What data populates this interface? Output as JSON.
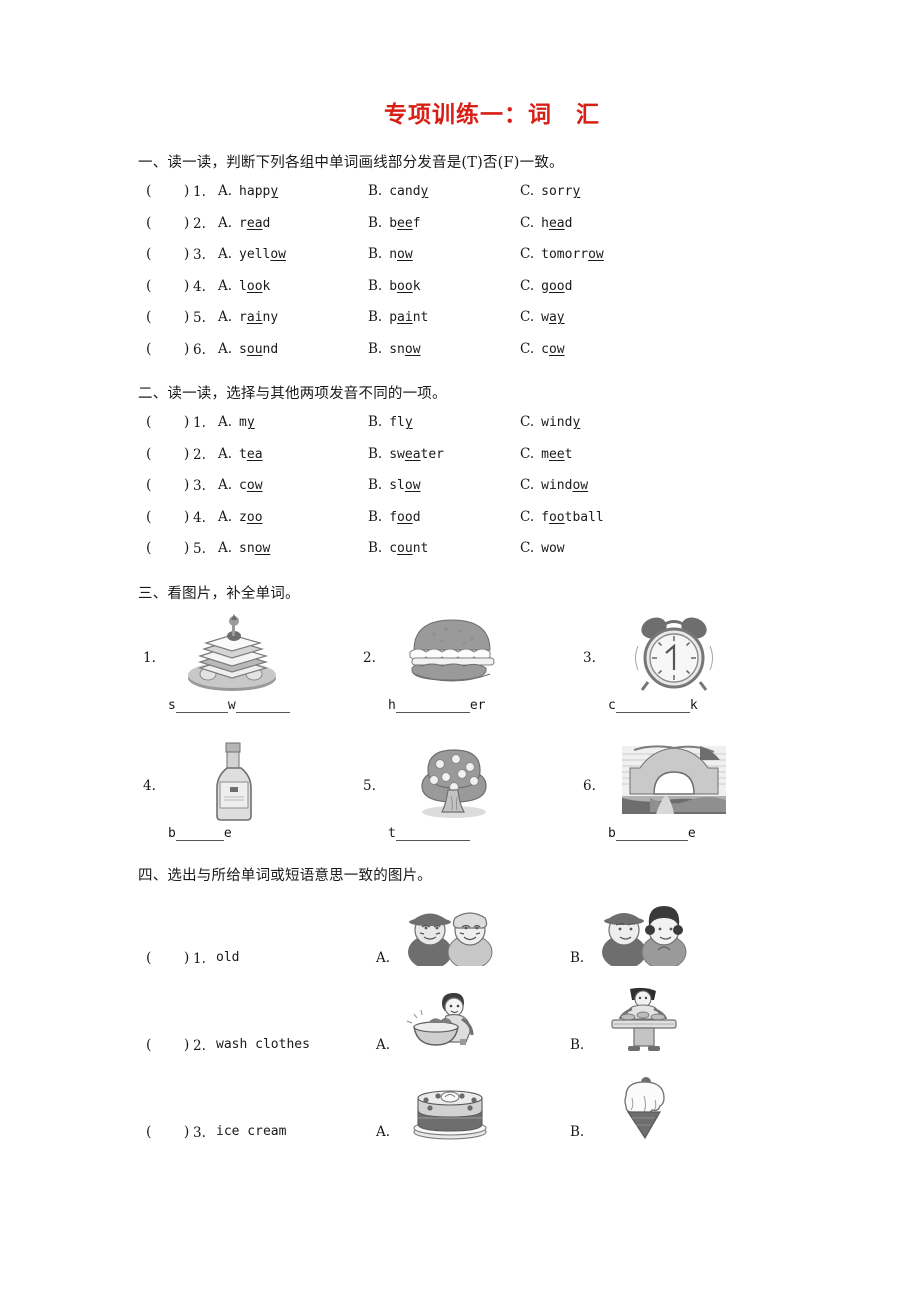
{
  "document": {
    "title": "专项训练一：词　汇",
    "title_color": "#d81f15"
  },
  "sections": [
    {
      "id": "section-1",
      "heading": "一、读一读，判断下列各组中单词画线部分发音是(T)否(F)一致。",
      "paren": "(    )",
      "questions": [
        {
          "num": "1.",
          "options": [
            {
              "label": "A.",
              "pre": "happ",
              "under": "y",
              "post": ""
            },
            {
              "label": "B.",
              "pre": "cand",
              "under": "y",
              "post": ""
            },
            {
              "label": "C.",
              "pre": "sorr",
              "under": "y",
              "post": ""
            }
          ]
        },
        {
          "num": "2.",
          "options": [
            {
              "label": "A.",
              "pre": "r",
              "under": "ea",
              "post": "d"
            },
            {
              "label": "B.",
              "pre": "b",
              "under": "ee",
              "post": "f"
            },
            {
              "label": "C.",
              "pre": "h",
              "under": "ea",
              "post": "d"
            }
          ]
        },
        {
          "num": "3.",
          "options": [
            {
              "label": "A.",
              "pre": "yell",
              "under": "ow",
              "post": ""
            },
            {
              "label": "B.",
              "pre": "n",
              "under": "ow",
              "post": ""
            },
            {
              "label": "C.",
              "pre": "tomorr",
              "under": "ow",
              "post": ""
            }
          ]
        },
        {
          "num": "4.",
          "options": [
            {
              "label": "A.",
              "pre": "l",
              "under": "oo",
              "post": "k"
            },
            {
              "label": "B.",
              "pre": "b",
              "under": "oo",
              "post": "k"
            },
            {
              "label": "C.",
              "pre": "g",
              "under": "oo",
              "post": "d"
            }
          ]
        },
        {
          "num": "5.",
          "options": [
            {
              "label": "A.",
              "pre": "r",
              "under": "ai",
              "post": "ny"
            },
            {
              "label": "B.",
              "pre": "p",
              "under": "ai",
              "post": "nt"
            },
            {
              "label": "C.",
              "pre": "w",
              "under": "ay",
              "post": ""
            }
          ]
        },
        {
          "num": "6.",
          "options": [
            {
              "label": "A.",
              "pre": "s",
              "under": "ou",
              "post": "nd"
            },
            {
              "label": "B.",
              "pre": "sn",
              "under": "ow",
              "post": ""
            },
            {
              "label": "C.",
              "pre": "c",
              "under": "ow",
              "post": ""
            }
          ]
        }
      ]
    },
    {
      "id": "section-2",
      "heading": "二、读一读，选择与其他两项发音不同的一项。",
      "paren": "(    )",
      "questions": [
        {
          "num": "1.",
          "options": [
            {
              "label": "A.",
              "pre": "m",
              "under": "y",
              "post": ""
            },
            {
              "label": "B.",
              "pre": "fl",
              "under": "y",
              "post": ""
            },
            {
              "label": "C.",
              "pre": "wind",
              "under": "y",
              "post": ""
            }
          ]
        },
        {
          "num": "2.",
          "options": [
            {
              "label": "A.",
              "pre": "t",
              "under": "ea",
              "post": ""
            },
            {
              "label": "B.",
              "pre": "sw",
              "under": "ea",
              "post": "ter"
            },
            {
              "label": "C.",
              "pre": "m",
              "under": "ee",
              "post": "t"
            }
          ]
        },
        {
          "num": "3.",
          "options": [
            {
              "label": "A.",
              "pre": "c",
              "under": "ow",
              "post": ""
            },
            {
              "label": "B.",
              "pre": "sl",
              "under": "ow",
              "post": ""
            },
            {
              "label": "C.",
              "pre": "wind",
              "under": "ow",
              "post": ""
            }
          ]
        },
        {
          "num": "4.",
          "options": [
            {
              "label": "A.",
              "pre": "z",
              "under": "oo",
              "post": ""
            },
            {
              "label": "B.",
              "pre": "f",
              "under": "oo",
              "post": "d"
            },
            {
              "label": "C.",
              "pre": "f",
              "under": "oo",
              "post": "tball"
            }
          ]
        },
        {
          "num": "5.",
          "options": [
            {
              "label": "A.",
              "pre": "sn",
              "under": "ow",
              "post": ""
            },
            {
              "label": "B.",
              "pre": "c",
              "under": "ou",
              "post": "nt"
            },
            {
              "label": "C.",
              "pre": "wow",
              "under": "",
              "post": ""
            }
          ]
        }
      ]
    },
    {
      "id": "section-3",
      "heading": "三、看图片，补全单词。",
      "items": [
        {
          "num": "1.",
          "picture": "sandwich-image",
          "blank_before": "s",
          "blank_mid": "w",
          "blank_after": ""
        },
        {
          "num": "2.",
          "picture": "hamburger-image",
          "blank_before": "h",
          "blank_mid": "",
          "blank_after": "er"
        },
        {
          "num": "3.",
          "picture": "alarm-clock-image",
          "blank_before": "c",
          "blank_mid": "",
          "blank_after": "k"
        },
        {
          "num": "4.",
          "picture": "bottle-image",
          "blank_before": "b",
          "blank_mid": "",
          "blank_after": "e"
        },
        {
          "num": "5.",
          "picture": "tree-image",
          "blank_before": "t",
          "blank_mid": "",
          "blank_after": ""
        },
        {
          "num": "6.",
          "picture": "bridge-image",
          "blank_before": "b",
          "blank_mid": "",
          "blank_after": "e"
        }
      ]
    },
    {
      "id": "section-4",
      "heading": "四、选出与所给单词或短语意思一致的图片。",
      "paren": "(    )",
      "questions": [
        {
          "num": "1.",
          "prompt": "old",
          "options": [
            {
              "label": "A.",
              "picture": "old-couple-image"
            },
            {
              "label": "B.",
              "picture": "young-couple-image"
            }
          ]
        },
        {
          "num": "2.",
          "prompt": "wash clothes",
          "options": [
            {
              "label": "A.",
              "picture": "washing-clothes-image"
            },
            {
              "label": "B.",
              "picture": "cooking-at-table-image"
            }
          ]
        },
        {
          "num": "3.",
          "prompt": "ice cream",
          "options": [
            {
              "label": "A.",
              "picture": "cake-image"
            },
            {
              "label": "B.",
              "picture": "ice-cream-cone-image"
            }
          ]
        }
      ]
    }
  ]
}
